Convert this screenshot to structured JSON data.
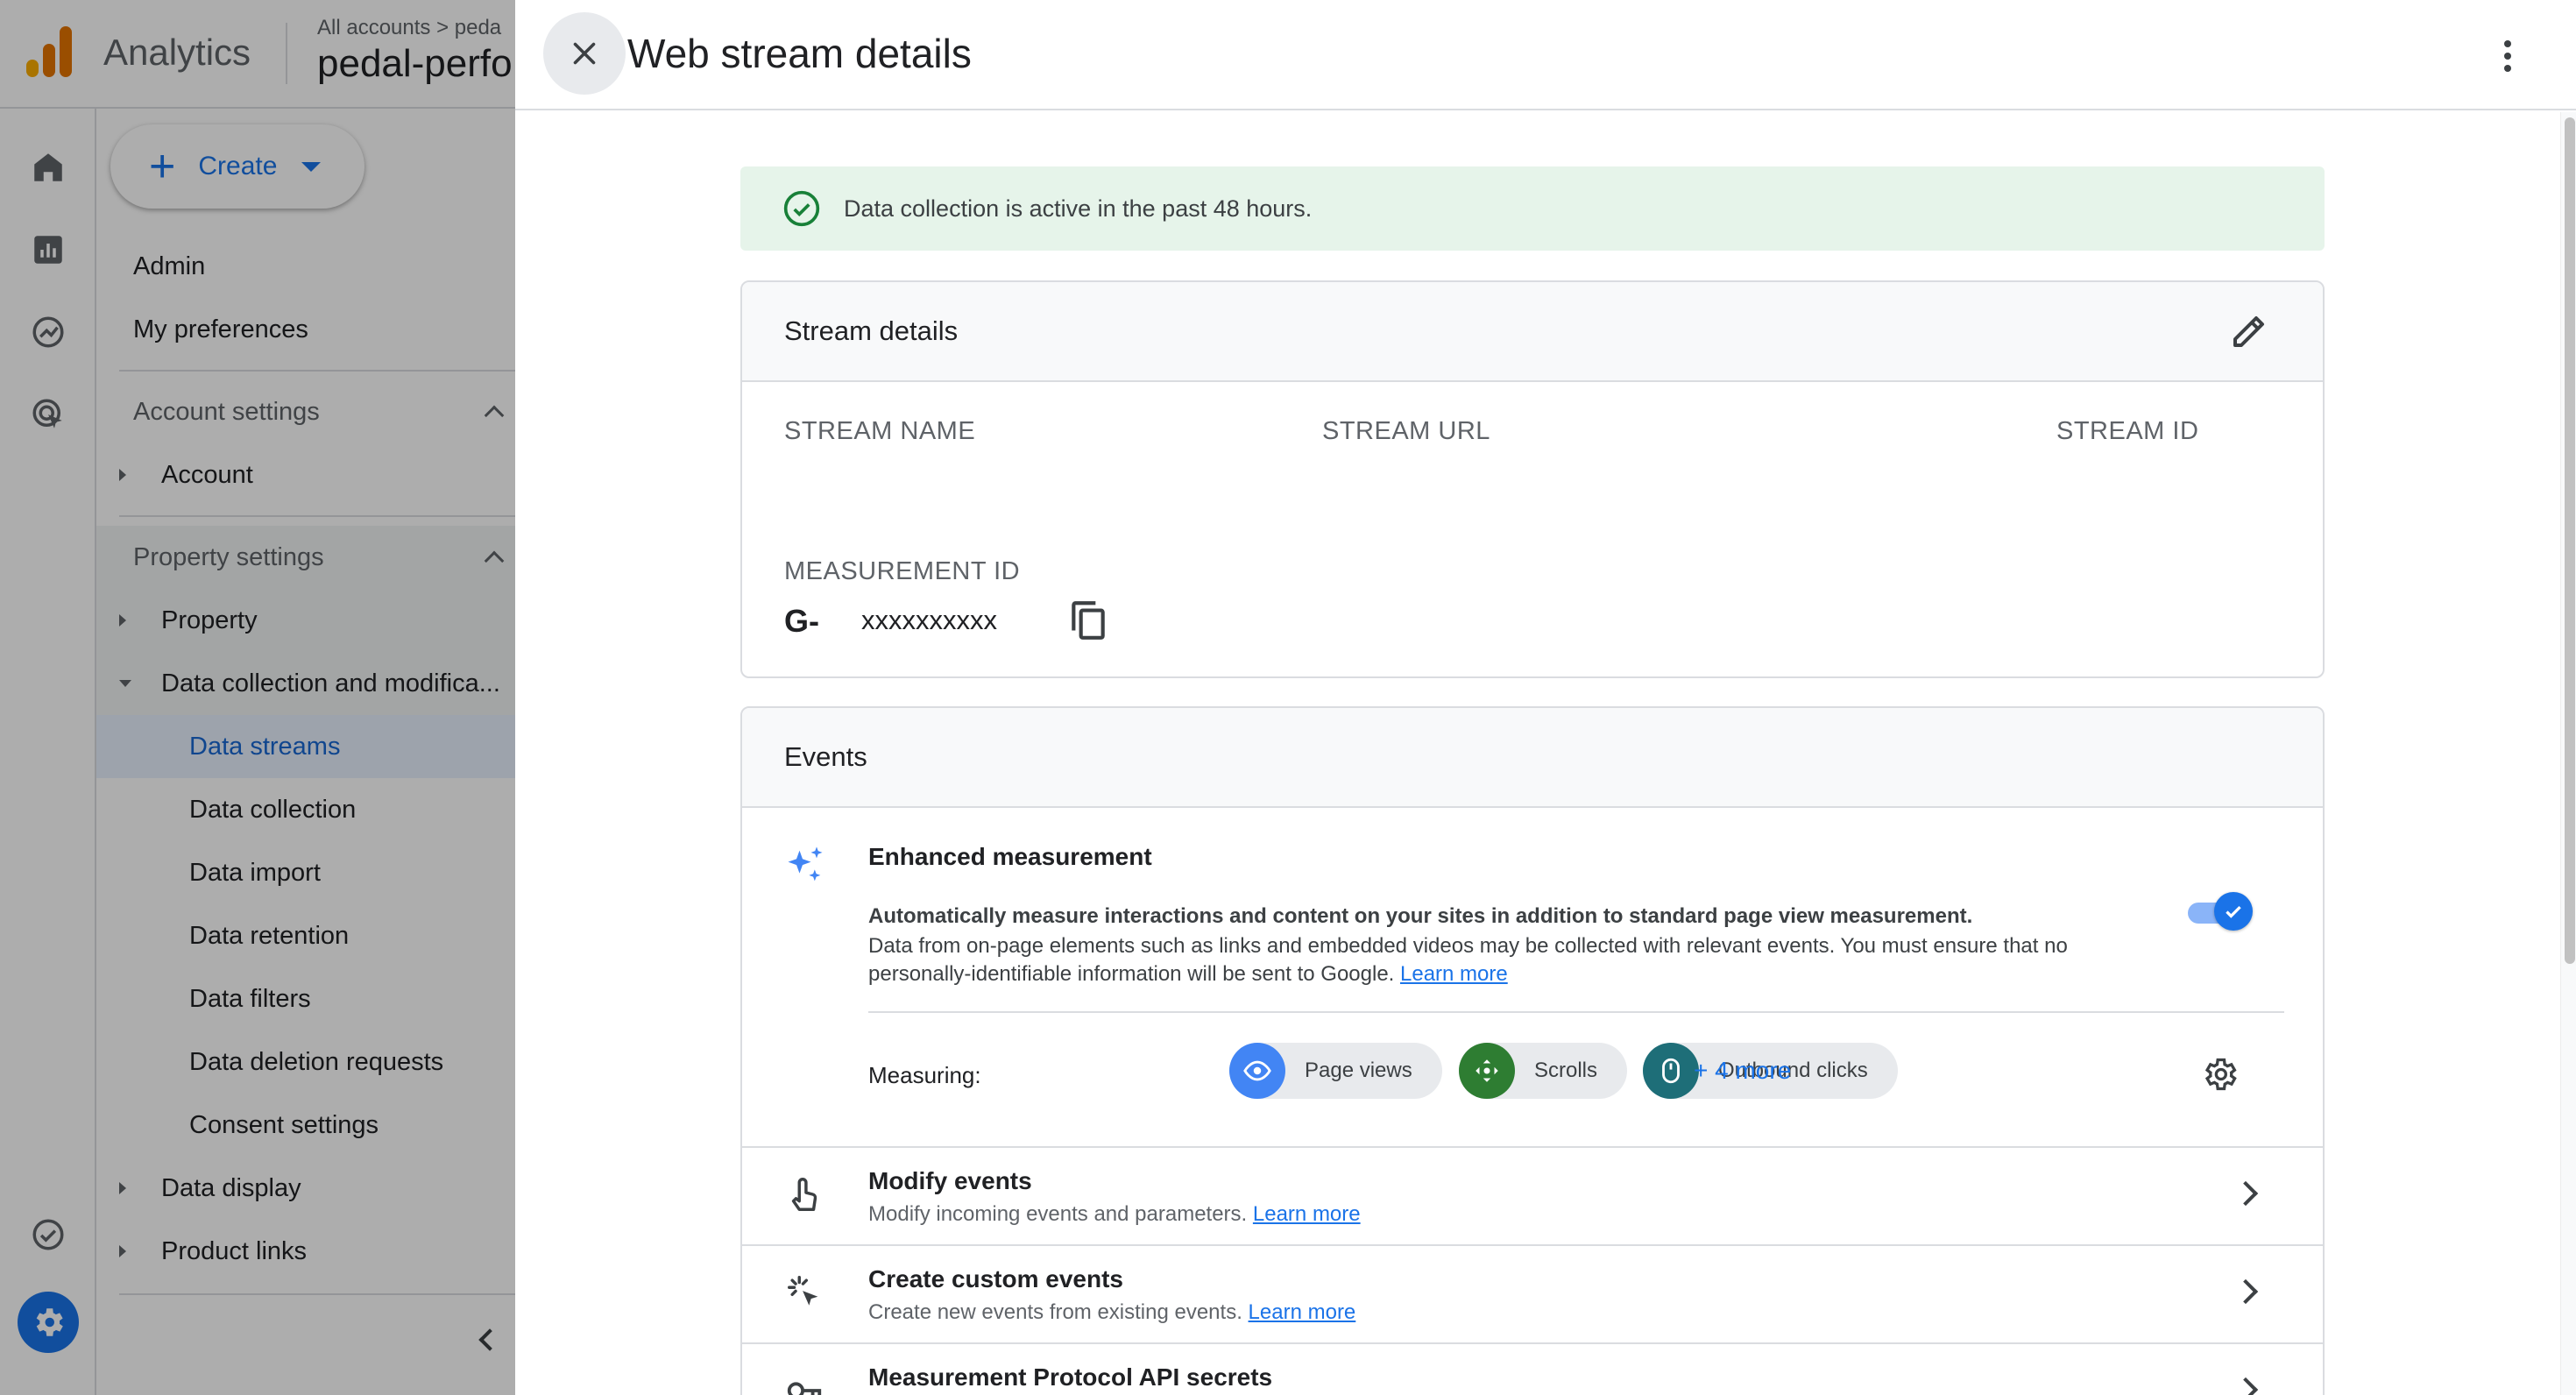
{
  "app": {
    "name": "Analytics",
    "breadcrumb": "All accounts > peda",
    "property_name": "pedal-perfo",
    "logo_colors": [
      "#f9ab00",
      "#e37400",
      "#e37400"
    ]
  },
  "rail": {
    "icons": [
      "home-icon",
      "reports-icon",
      "explore-icon",
      "advertising-icon",
      "insights-icon",
      "admin-gear-icon"
    ]
  },
  "sidebar": {
    "create_label": "Create",
    "admin": "Admin",
    "my_preferences": "My preferences",
    "account_settings": "Account settings",
    "account": "Account",
    "property_settings": "Property settings",
    "property": "Property",
    "data_collection_group": "Data collection and modifica...",
    "items": [
      "Data streams",
      "Data collection",
      "Data import",
      "Data retention",
      "Data filters",
      "Data deletion requests",
      "Consent settings"
    ],
    "data_display": "Data display",
    "product_links": "Product links"
  },
  "panel": {
    "title": "Web stream details",
    "status_text": "Data collection is active in the past 48 hours.",
    "stream_details_title": "Stream details",
    "col_stream_name": "STREAM NAME",
    "col_stream_url": "STREAM URL",
    "col_stream_id": "STREAM ID",
    "measurement_id_label": "MEASUREMENT ID",
    "measurement_id_prefix": "G-",
    "measurement_id_value": "xxxxxxxxxx",
    "events_title": "Events",
    "enhanced": {
      "title": "Enhanced measurement",
      "desc_bold": "Automatically measure interactions and content on your sites in addition to standard page view measurement.",
      "desc": "Data from on-page elements such as links and embedded videos may be collected with relevant events. You must ensure that no personally-identifiable information will be sent to Google.",
      "learn_more": "Learn more",
      "toggle_on": true,
      "measuring_label": "Measuring:",
      "chips": [
        "Page views",
        "Scrolls",
        "Outbound clicks"
      ],
      "more": "+ 4 more"
    },
    "rows": [
      {
        "title": "Modify events",
        "sub": "Modify incoming events and parameters.",
        "link": "Learn more"
      },
      {
        "title": "Create custom events",
        "sub": "Create new events from existing events.",
        "link": "Learn more"
      },
      {
        "title": "Measurement Protocol API secrets",
        "sub": "",
        "link": ""
      }
    ]
  },
  "colors": {
    "accent": "#1a73e8",
    "status_bg": "#e6f4ea",
    "status_green": "#188038",
    "chip_pageviews": "#4285f4",
    "chip_scrolls": "#2e7d32",
    "chip_outbound": "#1e6e78"
  }
}
